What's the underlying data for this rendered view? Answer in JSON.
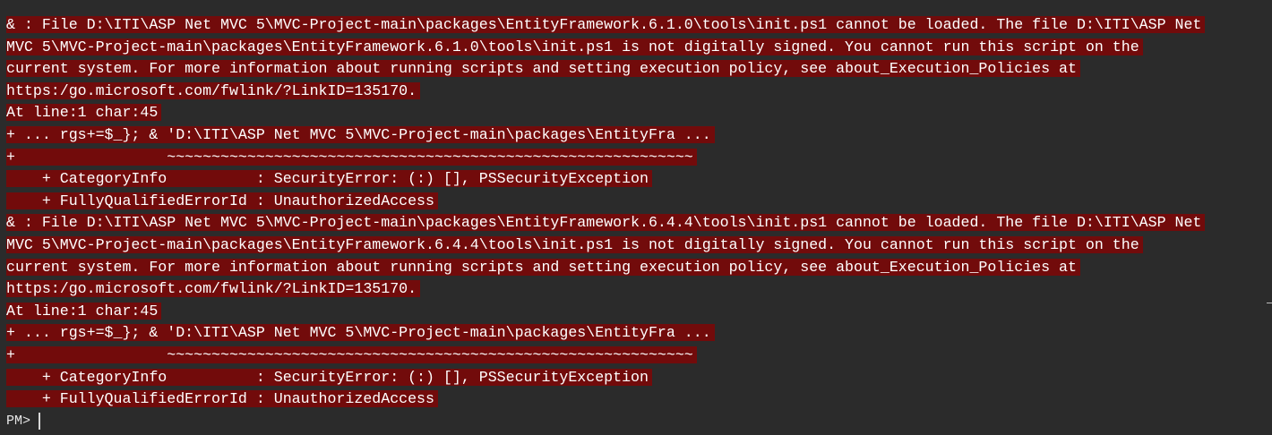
{
  "console": {
    "lines": [
      "& : File D:\\ITI\\ASP Net MVC 5\\MVC-Project-main\\packages\\EntityFramework.6.1.0\\tools\\init.ps1 cannot be loaded. The file D:\\ITI\\ASP Net",
      "MVC 5\\MVC-Project-main\\packages\\EntityFramework.6.1.0\\tools\\init.ps1 is not digitally signed. You cannot run this script on the",
      "current system. For more information about running scripts and setting execution policy, see about_Execution_Policies at",
      "https:/go.microsoft.com/fwlink/?LinkID=135170.",
      "At line:1 char:45",
      "+ ... rgs+=$_}; & 'D:\\ITI\\ASP Net MVC 5\\MVC-Project-main\\packages\\EntityFra ...",
      "+                 ~~~~~~~~~~~~~~~~~~~~~~~~~~~~~~~~~~~~~~~~~~~~~~~~~~~~~~~~~~~",
      "    + CategoryInfo          : SecurityError: (:) [], PSSecurityException",
      "    + FullyQualifiedErrorId : UnauthorizedAccess",
      "& : File D:\\ITI\\ASP Net MVC 5\\MVC-Project-main\\packages\\EntityFramework.6.4.4\\tools\\init.ps1 cannot be loaded. The file D:\\ITI\\ASP Net",
      "MVC 5\\MVC-Project-main\\packages\\EntityFramework.6.4.4\\tools\\init.ps1 is not digitally signed. You cannot run this script on the",
      "current system. For more information about running scripts and setting execution policy, see about_Execution_Policies at",
      "https:/go.microsoft.com/fwlink/?LinkID=135170.",
      "At line:1 char:45",
      "+ ... rgs+=$_}; & 'D:\\ITI\\ASP Net MVC 5\\MVC-Project-main\\packages\\EntityFra ...",
      "+                 ~~~~~~~~~~~~~~~~~~~~~~~~~~~~~~~~~~~~~~~~~~~~~~~~~~~~~~~~~~~",
      "    + CategoryInfo          : SecurityError: (:) [], PSSecurityException",
      "    + FullyQualifiedErrorId : UnauthorizedAccess"
    ],
    "prompt": "PM>"
  },
  "colors": {
    "background": "#2b2b2b",
    "error_background": "#720b0b",
    "text": "#ffffff"
  }
}
